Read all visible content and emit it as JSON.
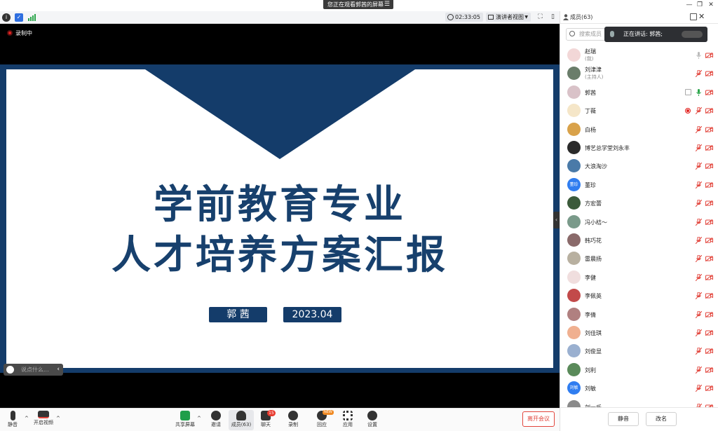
{
  "window": {
    "share_notice": "您正在观看郭茜的屏幕",
    "controls": [
      "—",
      "❐",
      "✕"
    ]
  },
  "toolbar_top": {
    "timer": "02:33:05",
    "view_mode": "演讲者视图"
  },
  "stage": {
    "recording_label": "录制中",
    "comment_placeholder": "说点什么..."
  },
  "slide": {
    "title_line1": "学前教育专业",
    "title_line2": "人才培养方案汇报",
    "presenter": "郭 茜",
    "date": "2023.04"
  },
  "bottombar": {
    "mute": "静音",
    "video": "开启视频",
    "share": "共享屏幕",
    "invite": "邀请",
    "members": "成员(63)",
    "chat": "聊天",
    "chat_badge": "15",
    "record": "录制",
    "reaction": "回应",
    "reaction_tag": "NEW",
    "apps": "应用",
    "settings": "设置",
    "leave": "离开会议"
  },
  "panel": {
    "title": "成员(63)",
    "search_placeholder": "搜索成员",
    "speaking_label": "正在讲话: 郭茜;",
    "members": [
      {
        "name": "赵瑞",
        "role": "(我)",
        "avatar_color": "#f2d7d7",
        "avatar_text": "",
        "mic": "on-gray",
        "cam": "off",
        "extra": ""
      },
      {
        "name": "刘津津",
        "role": "(主持人)",
        "avatar_color": "#6a7d6a",
        "avatar_text": "",
        "mic": "off",
        "cam": "off",
        "extra": ""
      },
      {
        "name": "郭茜",
        "role": "",
        "avatar_color": "#d9c2c8",
        "avatar_text": "",
        "mic": "on-green",
        "cam": "off",
        "extra": "share"
      },
      {
        "name": "丁薇",
        "role": "",
        "avatar_color": "#f5e6c8",
        "avatar_text": "",
        "mic": "off",
        "cam": "off",
        "extra": "rec"
      },
      {
        "name": "白杨",
        "role": "",
        "avatar_color": "#d9a24a",
        "avatar_text": "",
        "mic": "off",
        "cam": "off",
        "extra": ""
      },
      {
        "name": "博艺总学堂刘永丰",
        "role": "",
        "avatar_color": "#2a2a2a",
        "avatar_text": "",
        "mic": "off",
        "cam": "off",
        "extra": ""
      },
      {
        "name": "大浪淘沙",
        "role": "",
        "avatar_color": "#4a7aa8",
        "avatar_text": "",
        "mic": "off",
        "cam": "off",
        "extra": ""
      },
      {
        "name": "董珍",
        "role": "",
        "avatar_color": "#2f7df0",
        "avatar_text": "董珍",
        "mic": "off",
        "cam": "off",
        "extra": ""
      },
      {
        "name": "方宏蕾",
        "role": "",
        "avatar_color": "#3b5a3a",
        "avatar_text": "",
        "mic": "off",
        "cam": "off",
        "extra": ""
      },
      {
        "name": "冯小桔～",
        "role": "",
        "avatar_color": "#7a9a8a",
        "avatar_text": "",
        "mic": "off",
        "cam": "off",
        "extra": ""
      },
      {
        "name": "韩巧花",
        "role": "",
        "avatar_color": "#8a6a6a",
        "avatar_text": "",
        "mic": "off",
        "cam": "off",
        "extra": ""
      },
      {
        "name": "雷晨扬",
        "role": "",
        "avatar_color": "#b8b0a0",
        "avatar_text": "",
        "mic": "off",
        "cam": "off",
        "extra": ""
      },
      {
        "name": "李健",
        "role": "",
        "avatar_color": "#f0dede",
        "avatar_text": "",
        "mic": "off",
        "cam": "off",
        "extra": ""
      },
      {
        "name": "李佩英",
        "role": "",
        "avatar_color": "#c24a4a",
        "avatar_text": "",
        "mic": "off",
        "cam": "off",
        "extra": ""
      },
      {
        "name": "李倩",
        "role": "",
        "avatar_color": "#b08080",
        "avatar_text": "",
        "mic": "off",
        "cam": "off",
        "extra": ""
      },
      {
        "name": "刘佳琪",
        "role": "",
        "avatar_color": "#f0b090",
        "avatar_text": "",
        "mic": "off",
        "cam": "off",
        "extra": ""
      },
      {
        "name": "刘俊显",
        "role": "",
        "avatar_color": "#9ab0d0",
        "avatar_text": "",
        "mic": "off",
        "cam": "off",
        "extra": ""
      },
      {
        "name": "刘利",
        "role": "",
        "avatar_color": "#5a8a5a",
        "avatar_text": "",
        "mic": "off",
        "cam": "off",
        "extra": ""
      },
      {
        "name": "刘敏",
        "role": "",
        "avatar_color": "#2f7df0",
        "avatar_text": "刘敏",
        "mic": "off",
        "cam": "off",
        "extra": ""
      },
      {
        "name": "刘一乐",
        "role": "",
        "avatar_color": "#8a8a8a",
        "avatar_text": "",
        "mic": "off",
        "cam": "off",
        "extra": ""
      }
    ],
    "mute_all": "静音",
    "rename": "改名"
  },
  "colors": {
    "slide_navy": "#17406d",
    "mic_off": "#e2453c",
    "mic_on": "#2aa54a",
    "leave": "#e2453c"
  }
}
